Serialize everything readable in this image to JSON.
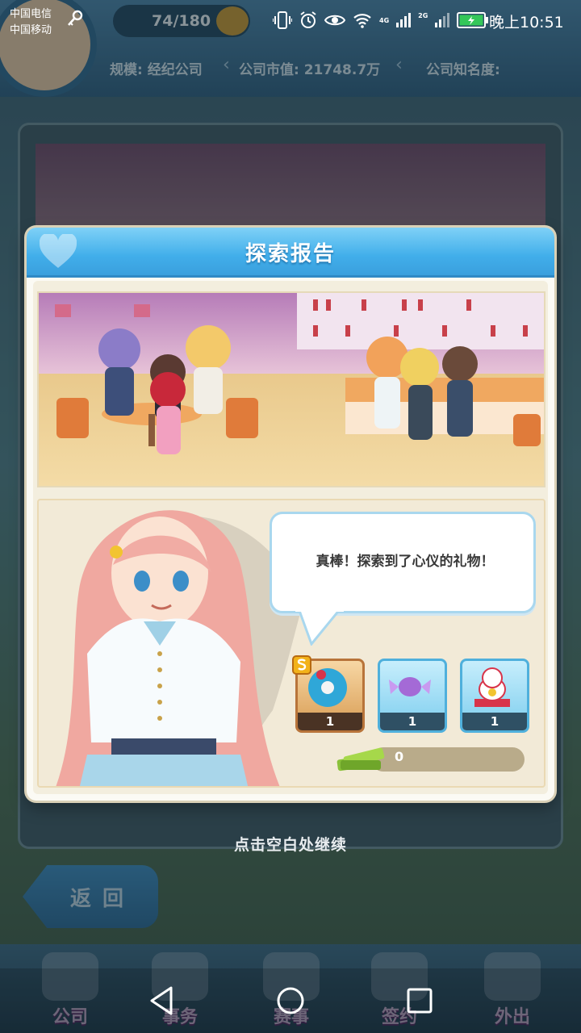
{
  "status_bar": {
    "carrier_1": "中国电信",
    "carrier_2": "中国移动",
    "network_4g": "4G",
    "network_2g": "2G",
    "clock": "晚上10:51"
  },
  "hud": {
    "energy": "74/180",
    "scale": "规模: 经纪公司",
    "market_value": "公司市值: 21748.7万",
    "fame": "公司知名度:"
  },
  "dialog": {
    "title": "探索报告",
    "message": "真棒！探索到了心仪的礼物！",
    "rewards": [
      {
        "name": "dance-disc-item",
        "count": "1",
        "rank": "S"
      },
      {
        "name": "candy-item",
        "count": "1"
      },
      {
        "name": "lucky-cat-item",
        "count": "1"
      }
    ],
    "cash": "0"
  },
  "tap_hint": "点击空白处继续",
  "back_button_label": "返回",
  "bottom_tabs": [
    {
      "label": "公司"
    },
    {
      "label": "事务"
    },
    {
      "label": "赛事"
    },
    {
      "label": "签约"
    },
    {
      "label": "外出"
    }
  ],
  "colors": {
    "dialog_header": "#41aeea",
    "bubble_border": "#a9d7ee",
    "reward_frame": "#4fb0dc",
    "reward_s_frame": "#b8743a"
  }
}
